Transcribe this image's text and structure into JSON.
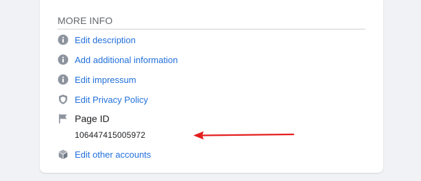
{
  "more_info": {
    "title": "MORE INFO",
    "items": [
      {
        "label": "Edit description",
        "icon": "info-icon"
      },
      {
        "label": "Add additional information",
        "icon": "info-icon"
      },
      {
        "label": "Edit impressum",
        "icon": "info-icon"
      },
      {
        "label": "Edit Privacy Policy",
        "icon": "shield-icon"
      }
    ],
    "page_id": {
      "label": "Page ID",
      "icon": "flag-icon",
      "value": "106447415005972"
    },
    "other_accounts": {
      "label": "Edit other accounts",
      "icon": "cube-icon"
    }
  },
  "colors": {
    "link": "#216fdb",
    "annotation_arrow": "#e41e1e",
    "icon": "#8d949e"
  }
}
